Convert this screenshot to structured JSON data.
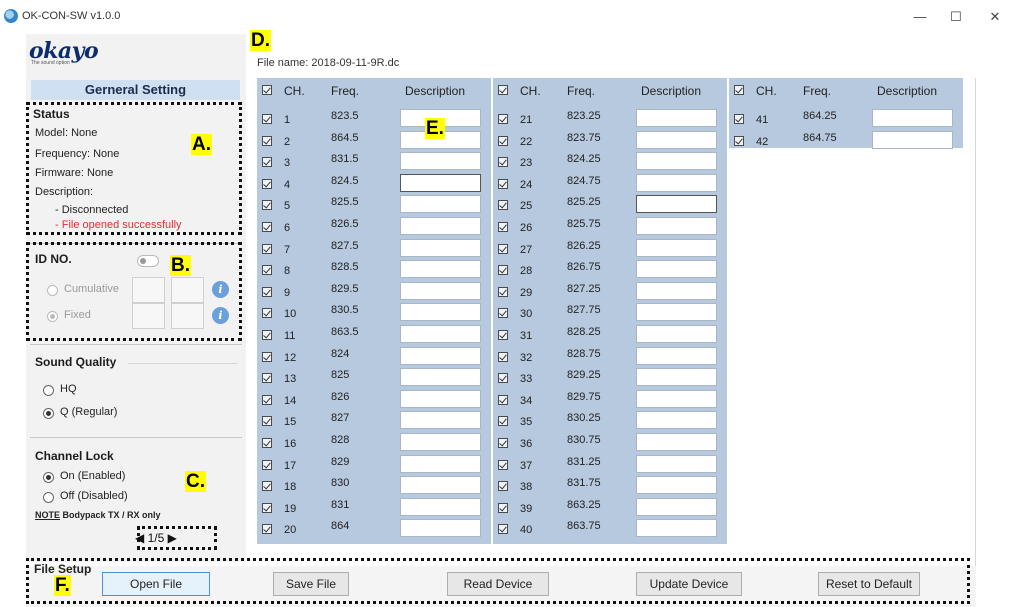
{
  "window": {
    "title": "OK-CON-SW v1.0.0",
    "minimize": "—",
    "maximize": "☐",
    "close": "✕"
  },
  "logo": {
    "text": "okayo",
    "tagline": "The sound option"
  },
  "sidebar": {
    "header": "Gerneral Setting",
    "status": {
      "title": "Status",
      "model": "Model:  None",
      "frequency": "Frequency:  None",
      "firmware": "Firmware:   None",
      "description_label": "Description:",
      "line1": "- Disconnected",
      "line2": "- File opened successfully"
    },
    "id_no": {
      "title": "ID NO.",
      "cumulative": "Cumulative",
      "fixed": "Fixed",
      "info": "i"
    },
    "sound_quality": {
      "title": "Sound Quality",
      "options": [
        "HQ",
        "Q (Regular)"
      ],
      "selected": "Q (Regular)"
    },
    "channel_lock": {
      "title": "Channel Lock",
      "options": [
        "On (Enabled)",
        "Off (Disabled)"
      ],
      "selected": "On (Enabled)",
      "note_prefix": "NOTE",
      "note": " Bodypack TX / RX only"
    },
    "pager": {
      "prev": "◀",
      "text": "1/5",
      "next": "▶"
    }
  },
  "file": {
    "name": "File name: 2018-09-11-9R.dc"
  },
  "table": {
    "headers": {
      "ch": "CH.",
      "freq": "Freq.",
      "desc": "Description"
    },
    "columns": [
      {
        "rows": [
          {
            "ch": "1",
            "freq": "823.5"
          },
          {
            "ch": "2",
            "freq": "864.5"
          },
          {
            "ch": "3",
            "freq": "831.5"
          },
          {
            "ch": "4",
            "freq": "824.5"
          },
          {
            "ch": "5",
            "freq": "825.5"
          },
          {
            "ch": "6",
            "freq": "826.5"
          },
          {
            "ch": "7",
            "freq": "827.5"
          },
          {
            "ch": "8",
            "freq": "828.5"
          },
          {
            "ch": "9",
            "freq": "829.5"
          },
          {
            "ch": "10",
            "freq": "830.5"
          },
          {
            "ch": "11",
            "freq": "863.5"
          },
          {
            "ch": "12",
            "freq": "824"
          },
          {
            "ch": "13",
            "freq": "825"
          },
          {
            "ch": "14",
            "freq": "826"
          },
          {
            "ch": "15",
            "freq": "827"
          },
          {
            "ch": "16",
            "freq": "828"
          },
          {
            "ch": "17",
            "freq": "829"
          },
          {
            "ch": "18",
            "freq": "830"
          },
          {
            "ch": "19",
            "freq": "831"
          },
          {
            "ch": "20",
            "freq": "864"
          }
        ]
      },
      {
        "rows": [
          {
            "ch": "21",
            "freq": "823.25"
          },
          {
            "ch": "22",
            "freq": "823.75"
          },
          {
            "ch": "23",
            "freq": "824.25"
          },
          {
            "ch": "24",
            "freq": "824.75"
          },
          {
            "ch": "25",
            "freq": "825.25"
          },
          {
            "ch": "26",
            "freq": "825.75"
          },
          {
            "ch": "27",
            "freq": "826.25"
          },
          {
            "ch": "28",
            "freq": "826.75"
          },
          {
            "ch": "29",
            "freq": "827.25"
          },
          {
            "ch": "30",
            "freq": "827.75"
          },
          {
            "ch": "31",
            "freq": "828.25"
          },
          {
            "ch": "32",
            "freq": "828.75"
          },
          {
            "ch": "33",
            "freq": "829.25"
          },
          {
            "ch": "34",
            "freq": "829.75"
          },
          {
            "ch": "35",
            "freq": "830.25"
          },
          {
            "ch": "36",
            "freq": "830.75"
          },
          {
            "ch": "37",
            "freq": "831.25"
          },
          {
            "ch": "38",
            "freq": "831.75"
          },
          {
            "ch": "39",
            "freq": "863.25"
          },
          {
            "ch": "40",
            "freq": "863.75"
          }
        ]
      },
      {
        "rows": [
          {
            "ch": "41",
            "freq": "864.25"
          },
          {
            "ch": "42",
            "freq": "864.75"
          }
        ]
      }
    ]
  },
  "file_setup": {
    "legend": "File Setup",
    "buttons": [
      "Open File",
      "Save File",
      "Read Device",
      "Update Device",
      "Reset to Default"
    ]
  },
  "annotations": [
    "A.",
    "B.",
    "C.",
    "D.",
    "E.",
    "F."
  ],
  "colors": {
    "panel": "#b7c9df",
    "header_bar": "#cfe0f2",
    "status_red": "#e03030",
    "annotation_highlight": "#ffff00",
    "logo": "#0d2c6b"
  }
}
